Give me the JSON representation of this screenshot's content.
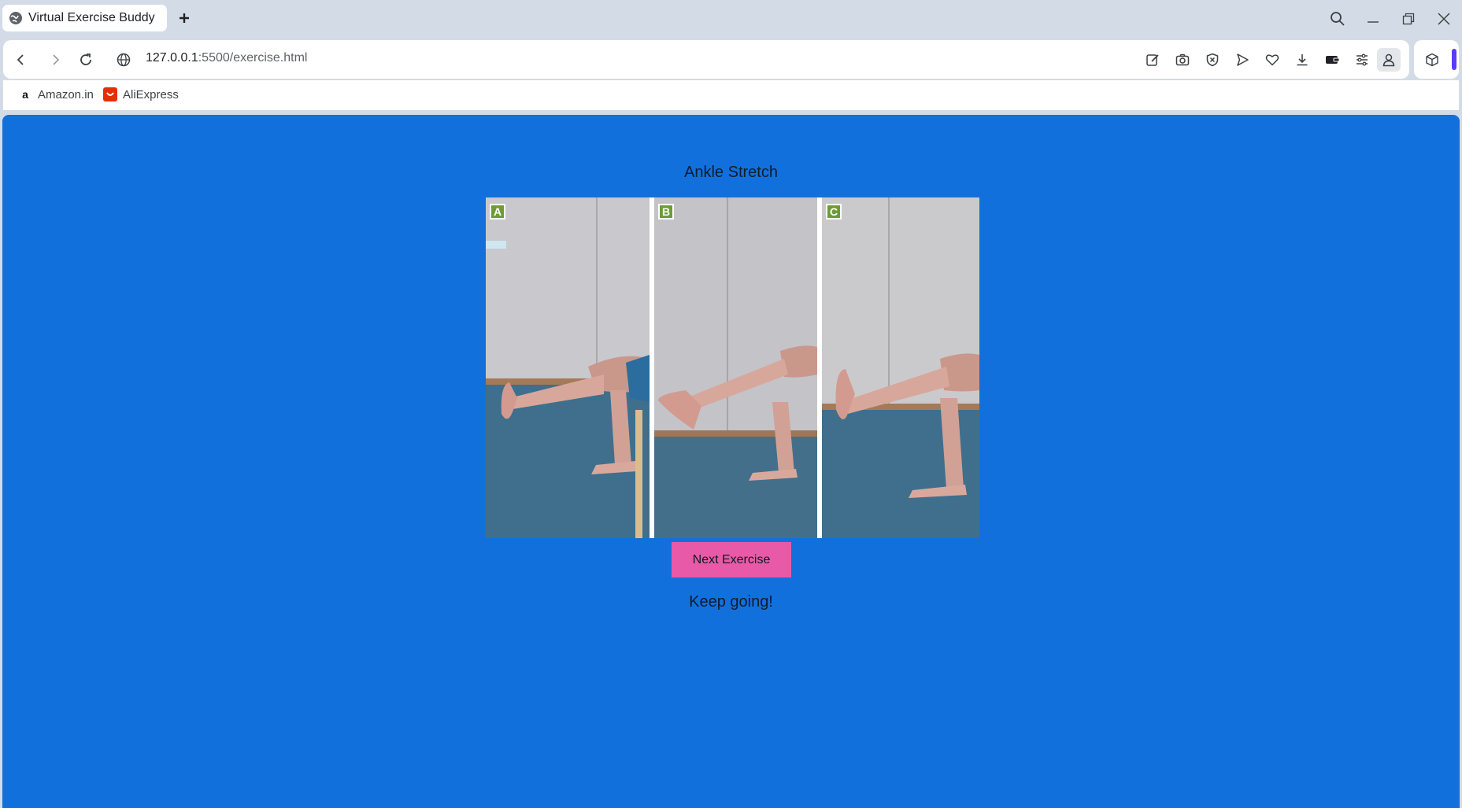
{
  "browser": {
    "tab_title": "Virtual Exercise Buddy",
    "url_host": "127.0.0.1",
    "url_rest": ":5500/exercise.html",
    "bookmarks": [
      {
        "label": "Amazon.in",
        "icon": "amazon-icon"
      },
      {
        "label": "AliExpress",
        "icon": "aliexpress-icon"
      }
    ]
  },
  "page": {
    "exercise_title": "Ankle Stretch",
    "panels": [
      {
        "label": "A"
      },
      {
        "label": "B"
      },
      {
        "label": "C"
      }
    ],
    "next_button": "Next Exercise",
    "status": "Keep going!"
  },
  "colors": {
    "page_background": "#1270dd",
    "button": "#e85aa8",
    "panel_label": "#6e9b3a"
  }
}
